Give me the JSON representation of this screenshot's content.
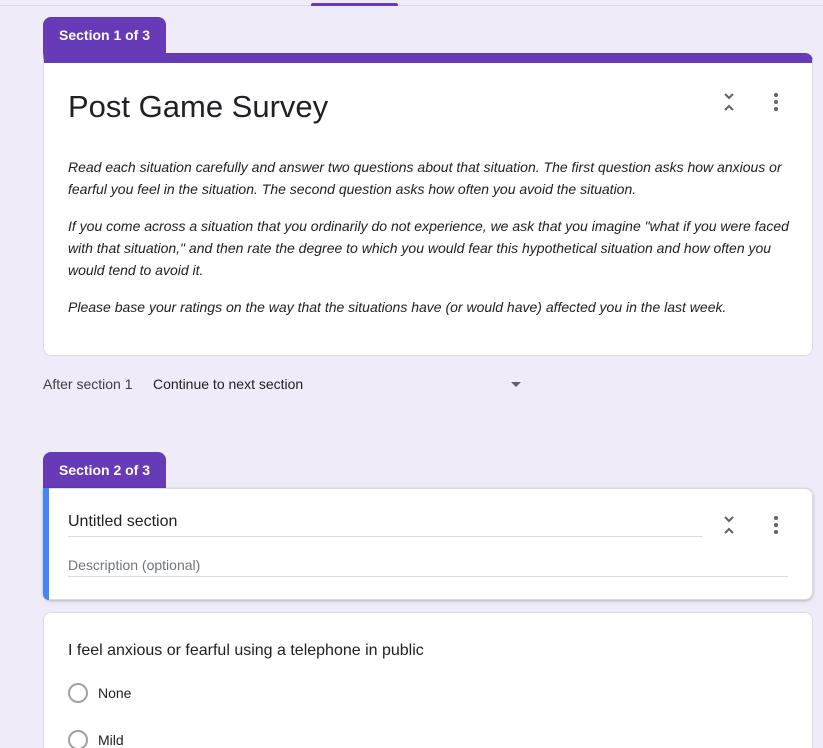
{
  "section1": {
    "tab_label": "Section 1 of 3",
    "title": "Post Game Survey",
    "description": [
      "Read each situation carefully and answer two questions about that situation. The first question asks how anxious or fearful you feel in the situation. The second question asks how often you avoid the situation.",
      "If you come across a situation that you ordinarily do not experience, we ask that you imagine \"what if you were faced with that situation,\" and then rate the degree to which you would fear this hypothetical situation and how often you would tend to avoid it.",
      "Please base your ratings on the way that the situations have (or would have) affected you in the last week."
    ]
  },
  "after_section": {
    "label": "After section 1",
    "value": "Continue to next section"
  },
  "section2": {
    "tab_label": "Section 2 of 3",
    "title": "Untitled section",
    "description_placeholder": "Description (optional)"
  },
  "question1": {
    "title": "I feel anxious or fearful using a telephone in public",
    "options": [
      "None",
      "Mild"
    ]
  },
  "icons": {
    "collapse": "collapse-icon",
    "more": "more-vert-icon"
  },
  "colors": {
    "accent": "#673ab7",
    "active_bar": "#4285f4",
    "background": "#f0ebf8"
  }
}
